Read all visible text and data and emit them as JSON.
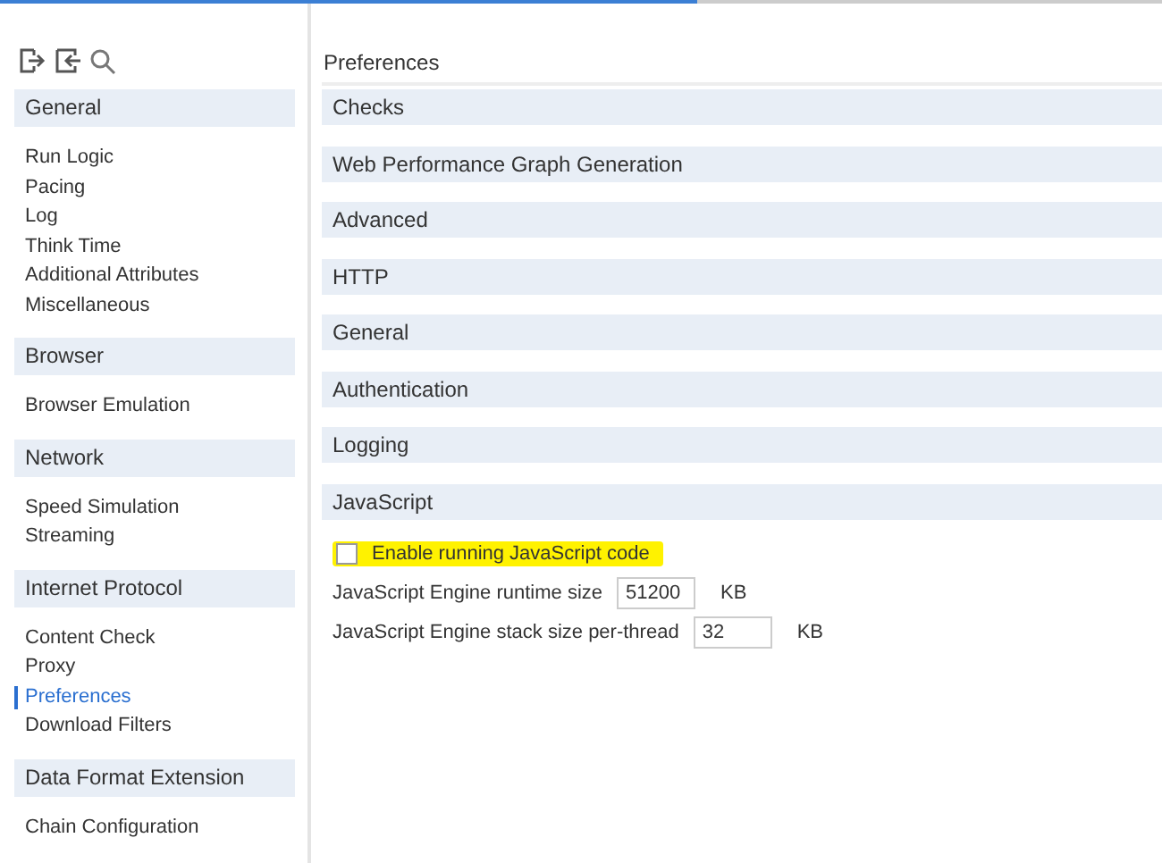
{
  "toolbar": {
    "buttons": [
      {
        "kind": "export"
      },
      {
        "kind": "import"
      },
      {
        "kind": "search"
      }
    ]
  },
  "sidebar": {
    "groups": [
      {
        "title": "General",
        "items": [
          {
            "label": "Run Logic",
            "selected": false
          },
          {
            "label": "Pacing",
            "selected": false
          },
          {
            "label": "Log",
            "selected": false
          },
          {
            "label": "Think Time",
            "selected": false
          },
          {
            "label": "Additional Attributes",
            "selected": false
          },
          {
            "label": "Miscellaneous",
            "selected": false
          }
        ]
      },
      {
        "title": "Browser",
        "items": [
          {
            "label": "Browser Emulation",
            "selected": false
          }
        ]
      },
      {
        "title": "Network",
        "items": [
          {
            "label": "Speed Simulation",
            "selected": false
          },
          {
            "label": "Streaming",
            "selected": false
          }
        ]
      },
      {
        "title": "Internet Protocol",
        "items": [
          {
            "label": "Content Check",
            "selected": false
          },
          {
            "label": "Proxy",
            "selected": false
          },
          {
            "label": "Preferences",
            "selected": true
          },
          {
            "label": "Download Filters",
            "selected": false
          }
        ]
      },
      {
        "title": "Data Format Extension",
        "items": [
          {
            "label": "Chain Configuration",
            "selected": false
          }
        ]
      }
    ]
  },
  "panel": {
    "title": "Preferences",
    "sections": [
      {
        "title": "Checks"
      },
      {
        "title": "Web Performance Graph Generation"
      },
      {
        "title": "Advanced"
      },
      {
        "title": "HTTP"
      },
      {
        "title": "General"
      },
      {
        "title": "Authentication"
      },
      {
        "title": "Logging"
      },
      {
        "title": "JavaScript"
      }
    ],
    "options": [
      {
        "kind": "checkbox",
        "label": "Enable running JavaScript code",
        "checked": false,
        "highlighted": true
      },
      {
        "kind": "number",
        "label": "JavaScript Engine runtime size",
        "value": "51200",
        "unit": "KB"
      },
      {
        "kind": "number",
        "label": "JavaScript Engine stack size per-thread",
        "value": "32",
        "unit": "KB"
      }
    ]
  }
}
